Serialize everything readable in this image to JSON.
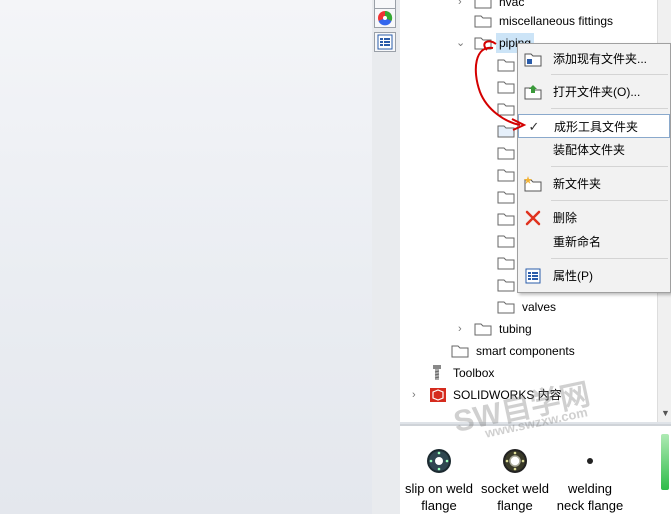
{
  "tree": {
    "rows": [
      {
        "label": "hvac",
        "chevron": "›"
      },
      {
        "label": "miscellaneous fittings",
        "chevron": ""
      },
      {
        "label": "piping",
        "chevron": "⌄"
      },
      {
        "label": "valves",
        "chevron": ""
      },
      {
        "label": "tubing",
        "chevron": "›"
      },
      {
        "label": "smart components",
        "chevron": ""
      },
      {
        "label": "Toolbox",
        "chevron": ""
      },
      {
        "label": "SOLIDWORKS 内容",
        "chevron": "›"
      }
    ]
  },
  "context_menu": {
    "items": [
      {
        "label": "添加现有文件夹...",
        "icon": "add-folder-icon"
      },
      {
        "label": "打开文件夹(O)...",
        "icon": "open-folder-icon"
      },
      {
        "label": "成形工具文件夹",
        "icon": "checkmark-icon"
      },
      {
        "label": "装配体文件夹",
        "icon": ""
      },
      {
        "label": "新文件夹",
        "icon": "new-folder-icon"
      },
      {
        "label": "删除",
        "icon": "delete-icon"
      },
      {
        "label": "重新命名",
        "icon": ""
      },
      {
        "label": "属性(P)",
        "icon": "properties-icon"
      }
    ]
  },
  "palette": {
    "items": [
      {
        "line1": "slip on weld",
        "line2": "flange"
      },
      {
        "line1": "socket weld",
        "line2": "flange"
      },
      {
        "line1": "welding",
        "line2": "neck flange"
      }
    ]
  },
  "watermark": {
    "line1": "SW自学网",
    "line2": "www.swzxw.com"
  },
  "colors": {
    "selection": "#cce4f7",
    "menu_bg": "#f2f2f2",
    "annotation": "#d40000",
    "delete_x": "#e0321e"
  }
}
